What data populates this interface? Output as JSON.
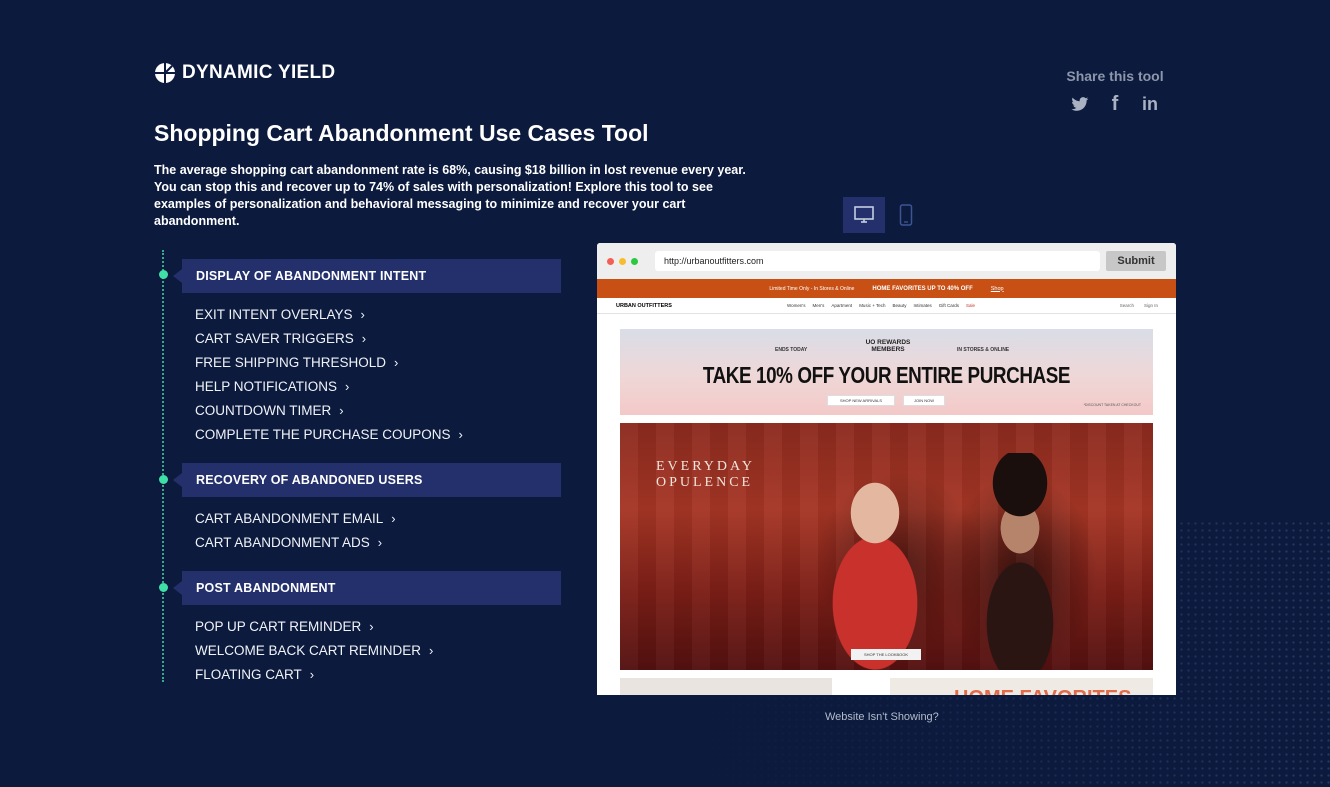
{
  "brand": {
    "name": "DYNAMIC YIELD"
  },
  "share": {
    "title": "Share this tool",
    "icons": [
      "twitter-icon",
      "facebook-icon",
      "linkedin-icon"
    ],
    "facebook_glyph": "f",
    "linkedin_glyph": "in"
  },
  "page": {
    "title": "Shopping Cart Abandonment Use Cases Tool",
    "description": "The average shopping cart abandonment rate is 68%, causing $18 billion in lost revenue every year. You can stop this and recover up to 74% of sales with personalization! Explore this tool to see examples of personalization and behavioral messaging to minimize and recover your cart abandonment."
  },
  "colors": {
    "background": "#0b1a3d",
    "section": "#23306b",
    "accent": "#3fe0a8"
  },
  "sections": [
    {
      "title": "DISPLAY OF ABANDONMENT INTENT",
      "items": [
        "EXIT INTENT OVERLAYS",
        "CART SAVER TRIGGERS",
        "FREE SHIPPING THRESHOLD",
        "HELP NOTIFICATIONS",
        "COUNTDOWN TIMER",
        "COMPLETE THE PURCHASE COUPONS"
      ]
    },
    {
      "title": "RECOVERY OF ABANDONED USERS",
      "items": [
        "CART ABANDONMENT EMAIL",
        "CART ABANDONMENT ADS"
      ]
    },
    {
      "title": "POST ABANDONMENT",
      "items": [
        "POP UP CART REMINDER",
        "WELCOME BACK CART REMINDER",
        "FLOATING CART"
      ]
    }
  ],
  "chevron": "›",
  "device_toggle": {
    "selected": "desktop",
    "options": [
      "desktop-icon",
      "mobile-icon"
    ]
  },
  "browser": {
    "url": "http://urbanoutfitters.com",
    "submit_label": "Submit",
    "site": {
      "promo_left": "Limited Time Only - In Stores & Online",
      "promo_main": "HOME FAVORITES UP TO 40% OFF",
      "promo_link": "Shop",
      "brand": "URBAN OUTFITTERS",
      "nav": [
        "Women's",
        "Men's",
        "Apartment",
        "Music + Tech",
        "Beauty",
        "Intimates",
        "Gift Cards",
        "Sale"
      ],
      "nav_right": [
        "Search",
        "Sign In"
      ],
      "banner": {
        "ends": "ENDS TODAY",
        "members": "UO REWARDS MEMBERS",
        "stores": "IN STORES & ONLINE",
        "headline": "TAKE 10% OFF YOUR ENTIRE PURCHASE",
        "btn1": "SHOP NEW ARRIVALS",
        "btn2": "JOIN NOW",
        "fine": "*DISCOUNT TAKEN AT CHECKOUT"
      },
      "hero": {
        "line1": "EVERYDAY",
        "line2": "OPULENCE",
        "cta": "SHOP THE LOOKBOOK"
      },
      "tile2_text": "HOME FAVORITES"
    }
  },
  "footer_link": "Website Isn't Showing?"
}
